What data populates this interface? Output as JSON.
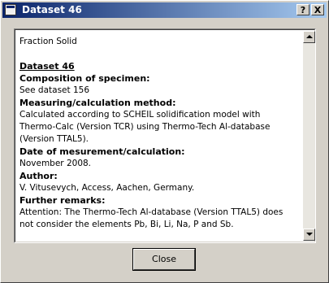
{
  "window": {
    "title": "Dataset 46",
    "help_button": "?",
    "close_button": "X"
  },
  "content": {
    "header_line": "Fraction Solid",
    "dataset_label": "Dataset 46",
    "composition_heading": "Composition of specimen:",
    "composition_text": "See dataset 156",
    "method_heading": "Measuring/calculation method:",
    "method_lines": [
      "Calculated according to SCHEIL solidification model with",
      "Thermo-Calc (Version TCR) using Thermo-Tech Al-database",
      "(Version TTAL5)."
    ],
    "date_heading": "Date of mesurement/calculation:",
    "date_text": "November 2008.",
    "author_heading": "Author:",
    "author_text": "V. Vitusevych, Access, Aachen, Germany.",
    "remarks_heading": "Further remarks:",
    "remarks_lines": [
      "Attention: The Thermo-Tech Al-database (Version TTAL5) does",
      "not consider the elements Pb, Bi, Li, Na, P and Sb."
    ]
  },
  "buttons": {
    "close": "Close"
  }
}
